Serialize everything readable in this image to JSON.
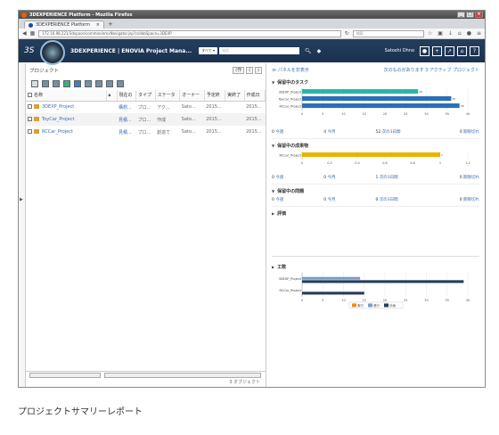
{
  "browser": {
    "title": "3DEXPERIENCE Platform - Mozilla Firefox",
    "tab_label": "3DEXPERIENCE Platform",
    "new_tab": "+",
    "url": "172.16.98.221/3dspace/common/emxNavigator.jsp?collabSpace=3DEXP",
    "search_placeholder": "検索"
  },
  "app": {
    "logo": "3S",
    "brand": "3DEXPERIENCE",
    "app_name": "ENOVIA Project Mana...",
    "tag_button": "すべて ▾",
    "search_placeholder": "検索",
    "user": "Satoshi Ohno"
  },
  "left": {
    "title": "プロジェクト",
    "nav_buttons": [
      "⟨作",
      "⟨",
      "⟩"
    ],
    "columns": [
      "名称",
      "",
      "現在の",
      "タイプ",
      "ステータ",
      "オーナー",
      "予定終",
      "実終了",
      "作成日"
    ],
    "rows": [
      {
        "name": "3DEXP_Project",
        "cur": "構想...",
        "type": "プロ...",
        "status": "アク...",
        "owner": "Sato...",
        "plan": "2015...",
        "actual": "",
        "created": "2015..."
      },
      {
        "name": "ToyCar_Project",
        "cur": "見積...",
        "type": "プロ...",
        "status": "作成",
        "owner": "Sato...",
        "plan": "2015...",
        "actual": "",
        "created": "2015..."
      },
      {
        "name": "RCCar_Project",
        "cur": "見積...",
        "type": "プロ...",
        "status": "創造て",
        "owner": "Sato...",
        "plan": "2015...",
        "actual": "",
        "created": "2015..."
      }
    ],
    "object_count": "3 オブジェクト"
  },
  "right": {
    "hide_panel": "≫ パネルを非表示",
    "next_label": "次のものがあります 3 アクティブ プロジェクト",
    "sections": {
      "tasks": {
        "title": "保留中のタスク",
        "counts": [
          {
            "n": "0",
            "t": "今週"
          },
          {
            "n": "4",
            "t": "今月"
          },
          {
            "n": "52",
            "t": "次の3日間"
          },
          {
            "n": "0",
            "t": "期限切れ"
          }
        ]
      },
      "deliverables": {
        "title": "保留中の成果物",
        "counts": [
          {
            "n": "0",
            "t": "今週"
          },
          {
            "n": "0",
            "t": "今月"
          },
          {
            "n": "1",
            "t": "次の3日間"
          },
          {
            "n": "0",
            "t": "期限切れ"
          }
        ]
      },
      "issues": {
        "title": "保留中の問題",
        "counts": [
          {
            "n": "0",
            "t": "今週"
          },
          {
            "n": "0",
            "t": "今月"
          },
          {
            "n": "0",
            "t": "次の3日間"
          },
          {
            "n": "0",
            "t": "期限切れ"
          }
        ]
      },
      "assessment": {
        "title": "評価"
      },
      "effort": {
        "title": "工数"
      }
    }
  },
  "caption": "プロジェクトサマリーレポート",
  "chart_data": [
    {
      "type": "bar",
      "orientation": "horizontal",
      "categories": [
        "3DEXP_Project",
        "ToyCar_Project",
        "RCCar_Project"
      ],
      "series": [
        {
          "values": [
            28,
            36,
            38
          ]
        }
      ],
      "colors": [
        "#2bb5a8",
        "#2a6fb8",
        "#2a6fb8"
      ],
      "xlim": [
        0,
        40
      ],
      "xticks": [
        0,
        5,
        10,
        15,
        20,
        25,
        30,
        35,
        40
      ]
    },
    {
      "type": "bar",
      "orientation": "horizontal",
      "categories": [
        "RCCar_Project"
      ],
      "series": [
        {
          "values": [
            1
          ]
        }
      ],
      "colors": [
        "#e8b400"
      ],
      "xlim": [
        0,
        1.2
      ],
      "xticks": [
        0,
        0.2,
        0.4,
        0.6,
        0.8,
        1,
        1.2
      ]
    },
    {
      "type": "bar",
      "orientation": "horizontal",
      "stacked": false,
      "categories": [
        "3DEXP_Project",
        "RCCar_Project"
      ],
      "series": [
        {
          "name": "実行",
          "values": [
            0,
            0
          ],
          "color": "#f08a1c"
        },
        {
          "name": "進行",
          "values": [
            14,
            0
          ],
          "color": "#7a9cc8"
        },
        {
          "name": "計画",
          "values": [
            39,
            15
          ],
          "color": "#253c5c"
        }
      ],
      "xlim": [
        0,
        40
      ],
      "xticks": [
        0,
        5,
        10,
        15,
        20,
        25,
        30,
        35,
        40
      ]
    }
  ]
}
